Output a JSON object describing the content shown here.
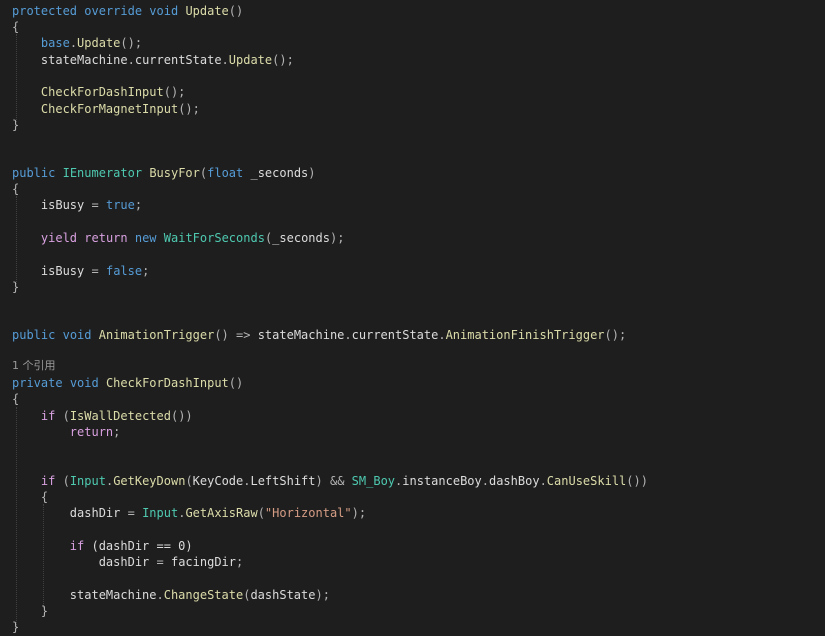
{
  "code": {
    "l1": {
      "kw1": "protected",
      "kw2": "override",
      "kw3": "void",
      "name": "Update",
      "paren": "()"
    },
    "l2": "{",
    "l3": {
      "obj": "base",
      "dot": ".",
      "fn": "Update",
      "tail": "();"
    },
    "l4": {
      "obj": "stateMachine",
      "dot1": ".",
      "mid": "currentState",
      "dot2": ".",
      "fn": "Update",
      "tail": "();"
    },
    "l5": {
      "fn": "CheckForDashInput",
      "tail": "();"
    },
    "l6": {
      "fn": "CheckForMagnetInput",
      "tail": "();"
    },
    "l7": "}",
    "l8": {
      "kw": "public",
      "type": "IEnumerator",
      "name": "BusyFor",
      "open": "(",
      "ptype": "float",
      "pname": "_seconds",
      "close": ")"
    },
    "l9": "{",
    "l10": {
      "var": "isBusy",
      "eq": "=",
      "val": "true",
      "semi": ";"
    },
    "l11": {
      "kw1": "yield",
      "kw2": "return",
      "kw3": "new",
      "type": "WaitForSeconds",
      "open": "(",
      "arg": "_seconds",
      "close": ");"
    },
    "l12": {
      "var": "isBusy",
      "eq": "=",
      "val": "false",
      "semi": ";"
    },
    "l13": "}",
    "l14": {
      "kw1": "public",
      "kw2": "void",
      "name": "AnimationTrigger",
      "paren": "()",
      "arrow": "=>",
      "obj": "stateMachine",
      "dot1": ".",
      "mid": "currentState",
      "dot2": ".",
      "fn": "AnimationFinishTrigger",
      "tail": "();"
    },
    "lens": "1 个引用",
    "l15": {
      "kw1": "private",
      "kw2": "void",
      "name": "CheckForDashInput",
      "paren": "()"
    },
    "l16": "{",
    "l17": {
      "kw": "if",
      "open": "(",
      "fn": "IsWallDetected",
      "close": "())"
    },
    "l18": {
      "kw": "return",
      "semi": ";"
    },
    "l19": {
      "kw": "if",
      "open": "(",
      "t1": "Input",
      "d1": ".",
      "f1": "GetKeyDown",
      "o1": "(",
      "t2": "KeyCode",
      "d2": ".",
      "v1": "LeftShift",
      "c1": ")",
      "and": "&&",
      "t3": "SM_Boy",
      "d3": ".",
      "v2": "instanceBoy",
      "d4": ".",
      "v3": "dashBoy",
      "d5": ".",
      "f2": "CanUseSkill",
      "tail": "())"
    },
    "l20": "{",
    "l21": {
      "var": "dashDir",
      "eq": "=",
      "type": "Input",
      "dot": ".",
      "fn": "GetAxisRaw",
      "open": "(",
      "str": "\"Horizontal\"",
      "close": ");"
    },
    "l22": {
      "kw": "if",
      "rest": "(dashDir == 0)"
    },
    "l23": {
      "var": "dashDir",
      "eq": "=",
      "val": "facingDir",
      "semi": ";"
    },
    "l24": {
      "obj": "stateMachine",
      "dot": ".",
      "fn": "ChangeState",
      "open": "(",
      "arg": "dashState",
      "close": ");"
    },
    "l25": "}",
    "l26": "}"
  }
}
